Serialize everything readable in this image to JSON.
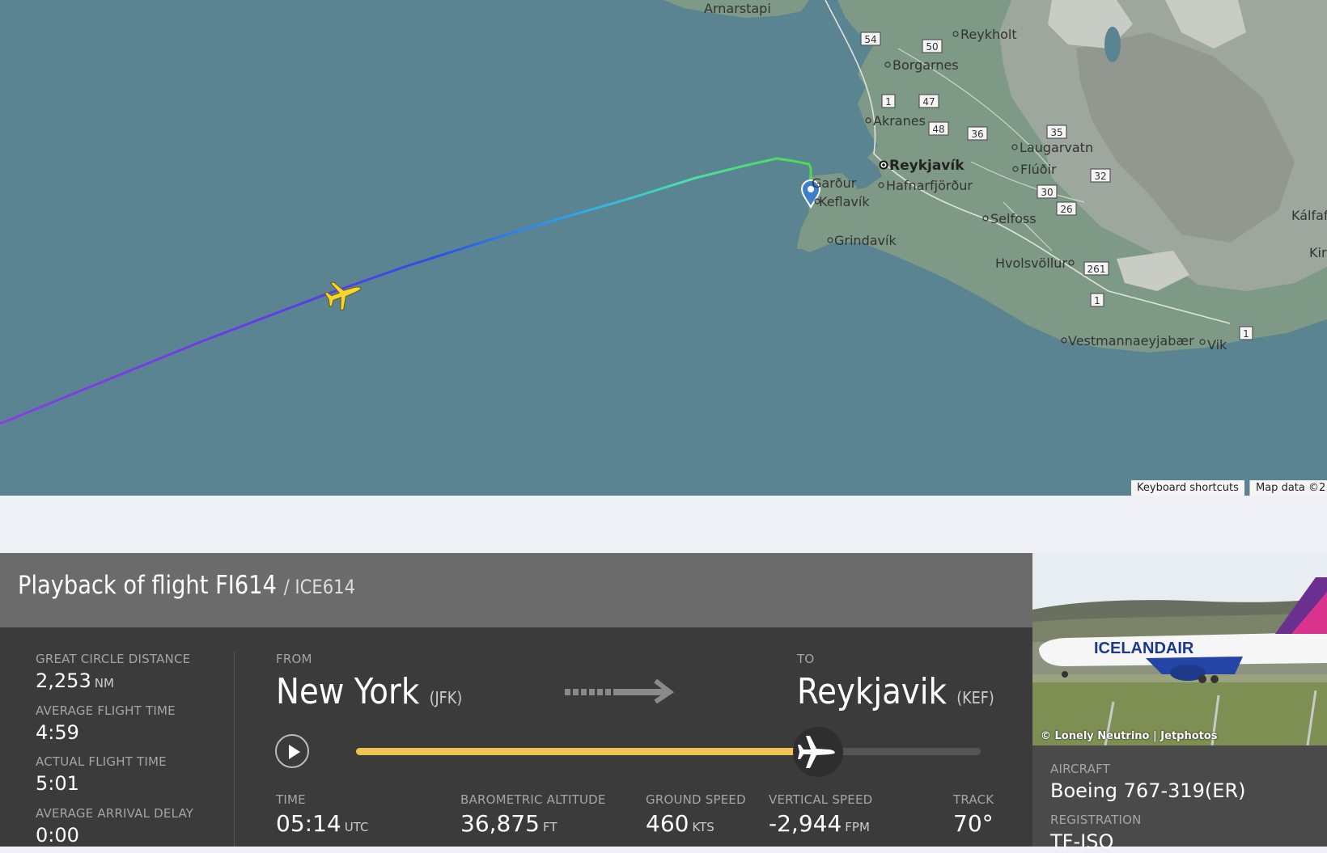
{
  "map": {
    "places": {
      "arnarstapi": "Arnarstapi",
      "reykholt": "Reykholt",
      "borgarnes": "Borgarnes",
      "akranes": "Akranes",
      "laugarvatn": "Laugarvatn",
      "reykjavik": "Reykjavík",
      "hafnarfjordur": "Hafnarfjörður",
      "gardur": "Garður",
      "keflavik": "Keflavík",
      "fludir": "Flúðir",
      "selfoss": "Selfoss",
      "grindavik": "Grindavík",
      "hvolsvollur": "Hvolsvöllur",
      "vestmannaeyjabaer": "Vestmannaeyjabær",
      "vik": "Vik",
      "kalfafell": "Kálfaf",
      "kirkjubaejar": "Kir"
    },
    "road_shields": [
      "54",
      "50",
      "1",
      "47",
      "48",
      "36",
      "35",
      "32",
      "30",
      "26",
      "261",
      "1",
      "1"
    ],
    "keyboard_shortcuts": "Keyboard shortcuts",
    "map_data": "Map data ©2"
  },
  "title": {
    "main": "Playback of flight FI614",
    "sub": "/ ICE614"
  },
  "stats": {
    "gc_distance_label": "GREAT CIRCLE DISTANCE",
    "gc_distance_value": "2,253",
    "gc_distance_unit": "NM",
    "avg_flight_label": "AVERAGE FLIGHT TIME",
    "avg_flight_value": "4:59",
    "actual_flight_label": "ACTUAL FLIGHT TIME",
    "actual_flight_value": "5:01",
    "avg_delay_label": "AVERAGE ARRIVAL DELAY",
    "avg_delay_value": "0:00"
  },
  "route": {
    "from_label": "FROM",
    "from_city": "New York",
    "from_code": "(JFK)",
    "to_label": "TO",
    "to_city": "Reykjavik",
    "to_code": "(KEF)"
  },
  "playback": {
    "progress": 0.74
  },
  "telemetry": {
    "time_label": "TIME",
    "time_value": "05:14",
    "time_unit": "UTC",
    "alt_label": "BAROMETRIC ALTITUDE",
    "alt_value": "36,875",
    "alt_unit": "FT",
    "gs_label": "GROUND SPEED",
    "gs_value": "460",
    "gs_unit": "KTS",
    "vs_label": "VERTICAL SPEED",
    "vs_value": "-2,944",
    "vs_unit": "FPM",
    "track_label": "TRACK",
    "track_value": "70°"
  },
  "aircraft": {
    "photo_brand": "ICELANDAIR",
    "photo_credit": "© Lonely Neutrino | Jetphotos",
    "aircraft_label": "AIRCRAFT",
    "aircraft_value": "Boeing 767-319(ER)",
    "registration_label": "REGISTRATION",
    "registration_value": "TF-ISO"
  },
  "colors": {
    "sea": "#5b8492",
    "progress": "#f1c24f",
    "plane": "#f6d530"
  }
}
